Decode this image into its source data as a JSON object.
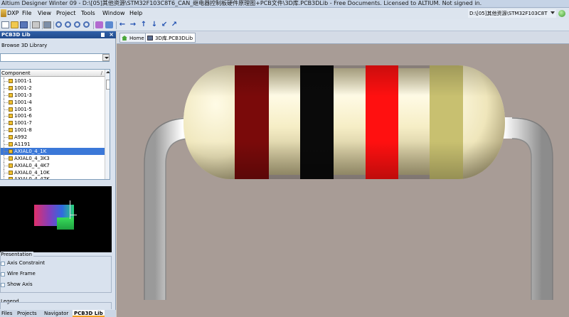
{
  "window": {
    "title": "Altium Designer Winter 09 - D:\\[05]其他资源\\STM32F103C8T6_CAN_继电器控制板硬件原理图+PCB文件\\3D库.PCB3DLib - Free Documents. Licensed to ALTIUM. Not signed in."
  },
  "menu": {
    "items": [
      "DXP",
      "File",
      "View",
      "Project",
      "Tools",
      "Window",
      "Help"
    ],
    "path_combo": "D:\\[05]其他资源\\STM32F103C8T"
  },
  "panel": {
    "title": "PCB3D Lib",
    "browse_label": "Browse 3D Library",
    "library_value": "",
    "list_header": "Component",
    "components": [
      "1001-1",
      "1001-2",
      "1001-3",
      "1001-4",
      "1001-5",
      "1001-6",
      "1001-7",
      "1001-8",
      "A992",
      "A1191",
      "AXIAL0_4_1K",
      "AXIAL0_4_3K3",
      "AXIAL0_4_4K7",
      "AXIAL0_4_10K",
      "AXIAL0_4_47K"
    ],
    "selected_index": 10,
    "presentation_label": "Presentation",
    "options": [
      {
        "label": "Axis Constraint",
        "checked": false
      },
      {
        "label": "Wire Frame",
        "checked": false
      },
      {
        "label": "Show Axis",
        "checked": false
      }
    ],
    "legend_label": "Legend",
    "bottom_tabs": [
      "Files",
      "Projects",
      "Navigator",
      "PCB3D Lib"
    ],
    "active_bottom_tab": 3
  },
  "document_tabs": [
    {
      "label": "Home",
      "icon": "home-icon"
    },
    {
      "label": "3D库.PCB3DLib",
      "icon": "pcb3d-document-icon"
    }
  ],
  "model": {
    "background_color": "#a89c96",
    "body_color": "#f8f0c8",
    "lead_color": "#e8e8e8",
    "bands": [
      "#7a0a0a",
      "#0a0a0a",
      "#ff1010",
      "#c8c070"
    ]
  }
}
